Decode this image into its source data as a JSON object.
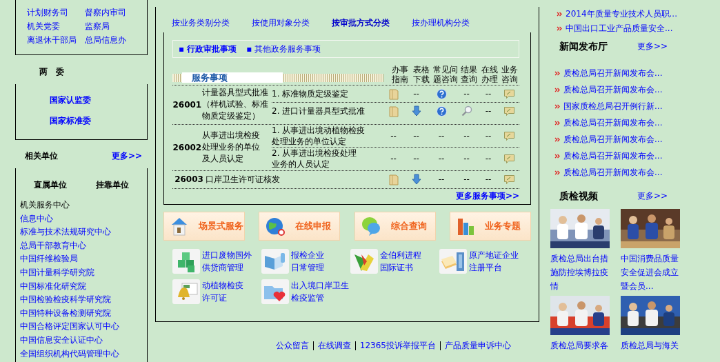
{
  "left": {
    "departments": [
      [
        "计划财务司",
        "督察内审司"
      ],
      [
        "机关党委",
        "监察局"
      ],
      [
        "离退休干部局",
        "总局信息办"
      ]
    ],
    "committees": {
      "title": "两　委",
      "links": [
        "国家认监委",
        "国家标准委"
      ]
    },
    "related": {
      "title": "相关单位",
      "more": "更多>>",
      "headers": [
        "直属单位",
        "挂靠单位"
      ],
      "items": [
        {
          "label": "机关服务中心",
          "visited": true
        },
        {
          "label": "信息中心",
          "visited": false
        },
        {
          "label": "标准与技术法规研究中心",
          "visited": false
        },
        {
          "label": "总局干部教育中心",
          "visited": false
        },
        {
          "label": "中国纤维检验局",
          "visited": false
        },
        {
          "label": "中国计量科学研究院",
          "visited": false
        },
        {
          "label": "中国标准化研究院",
          "visited": false
        },
        {
          "label": "中国检验检疫科学研究院",
          "visited": false
        },
        {
          "label": "中国特种设备检测研究院",
          "visited": false
        },
        {
          "label": "中国合格评定国家认可中心",
          "visited": false
        },
        {
          "label": "中国信息安全认证中心",
          "visited": false
        },
        {
          "label": "全国组织机构代码管理中心",
          "visited": false
        }
      ]
    }
  },
  "center": {
    "tabs": [
      {
        "label": "按业务类别分类",
        "selected": false
      },
      {
        "label": "按使用对象分类",
        "selected": false
      },
      {
        "label": "按审批方式分类",
        "selected": true
      },
      {
        "label": "按办理机构分类",
        "selected": false
      }
    ],
    "subtabs": [
      {
        "bullet": "▪",
        "label": "行政审批事项",
        "selected": true
      },
      {
        "bullet": "▪",
        "label": "其他政务服务事项",
        "selected": false
      }
    ],
    "table": {
      "title": "服务事项",
      "columns": [
        "办事指南",
        "表格下载",
        "常见问题咨询",
        "结果查询",
        "在线办理",
        "业务咨询"
      ],
      "rows": [
        {
          "code": "26001",
          "name": [
            "计量器具型式批准",
            "（样机试验、标准",
            "物质定级鉴定）"
          ],
          "items": [
            {
              "label": [
                "1. 标准物质定级鉴定"
              ],
              "cells": [
                {
                  "kind": "folder"
                },
                {
                  "kind": "text",
                  "text": "--"
                },
                {
                  "kind": "question"
                },
                {
                  "kind": "text",
                  "text": "--"
                },
                {
                  "kind": "text",
                  "text": "--"
                },
                {
                  "kind": "chat"
                }
              ]
            },
            {
              "label": [
                "2. 进口计量器具型式批准"
              ],
              "cells": [
                {
                  "kind": "folder"
                },
                {
                  "kind": "download"
                },
                {
                  "kind": "question"
                },
                {
                  "kind": "magnify"
                },
                {
                  "kind": "text",
                  "text": "--"
                },
                {
                  "kind": "chat"
                }
              ]
            }
          ]
        },
        {
          "code": "26002",
          "name": [
            "从事进出境检疫",
            "处理业务的单位",
            "及人员认定"
          ],
          "items": [
            {
              "label": [
                "1. 从事进出境动植物检疫",
                "处理业务的单位认定"
              ],
              "cells": [
                {
                  "kind": "text",
                  "text": "--"
                },
                {
                  "kind": "text",
                  "text": "--"
                },
                {
                  "kind": "text",
                  "text": "--"
                },
                {
                  "kind": "text",
                  "text": "--"
                },
                {
                  "kind": "text",
                  "text": "--"
                },
                {
                  "kind": "chat"
                }
              ]
            },
            {
              "label": [
                "2. 从事进出境检疫处理",
                "业务的人员认定"
              ],
              "cells": [
                {
                  "kind": "text",
                  "text": "--"
                },
                {
                  "kind": "text",
                  "text": "--"
                },
                {
                  "kind": "text",
                  "text": "--"
                },
                {
                  "kind": "text",
                  "text": "--"
                },
                {
                  "kind": "text",
                  "text": "--"
                },
                {
                  "kind": "chat"
                }
              ]
            }
          ]
        },
        {
          "code": "26003",
          "name": [
            "口岸卫生许可证核发"
          ],
          "items": [
            {
              "cells": [
                {
                  "kind": "folder"
                },
                {
                  "kind": "download"
                },
                {
                  "kind": "text",
                  "text": "--"
                },
                {
                  "kind": "text",
                  "text": "--"
                },
                {
                  "kind": "text",
                  "text": "--"
                },
                {
                  "kind": "chat"
                }
              ]
            }
          ]
        }
      ]
    },
    "more": "更多服务事项>>",
    "features": [
      {
        "label": "场景式服务",
        "kind": "house"
      },
      {
        "label": "在线申报",
        "kind": "globe"
      },
      {
        "label": "综合查询",
        "kind": "bubbles"
      },
      {
        "label": "业务专题",
        "kind": "bars"
      }
    ],
    "shortcuts": [
      {
        "lines": [
          "进口废物国外",
          "供货商管理"
        ],
        "kind": "cubes"
      },
      {
        "lines": [
          "报检企业",
          "日常管理"
        ],
        "kind": "brochure"
      },
      {
        "lines": [
          "金伯利进程",
          "国际证书"
        ],
        "kind": "arrows"
      },
      {
        "lines": [
          "原产地证企业",
          "注册平台"
        ],
        "kind": "papers"
      },
      {
        "lines": [
          "动植物检疫",
          "许可证"
        ],
        "kind": "bell"
      },
      {
        "lines": [
          "出入境口岸卫生",
          "检疫监管"
        ],
        "kind": "heart"
      }
    ]
  },
  "footer": [
    "公众留言",
    "在线调查",
    "12365投诉举报平台",
    "产品质量申诉中心"
  ],
  "right": {
    "news": [
      "2014年质量专业技术人员职...",
      "中国出口工业产品质量安全..."
    ],
    "press": {
      "title": "新闻发布厅",
      "more": "更多>>",
      "items": [
        "质检总局召开新闻发布会...",
        "质检总局召开新闻发布会...",
        "国家质检总局召开例行新...",
        "质检总局召开新闻发布会...",
        "质检总局召开新闻发布会...",
        "质检总局召开新闻发布会...",
        "质检总局召开新闻发布会..."
      ]
    },
    "video": {
      "title": "质检视频",
      "more": "更多>>",
      "items": [
        {
          "caption": [
            "质检总局出台措",
            "施防控埃博拉疫",
            "情"
          ]
        },
        {
          "caption": [
            "中国消费品质量",
            "安全促进会成立",
            "暨会员..."
          ]
        },
        {
          "caption": [
            "质检总局要求各"
          ]
        },
        {
          "caption": [
            "质检总局与海关"
          ]
        }
      ]
    }
  }
}
